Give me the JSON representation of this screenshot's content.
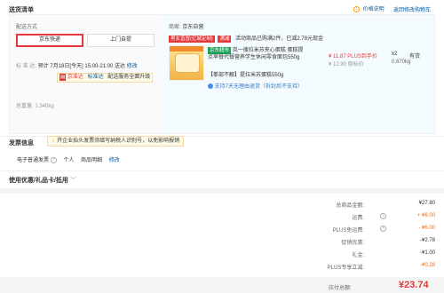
{
  "header": {
    "title": "送货清单",
    "price_note": "价格说明",
    "back_link": "返回修改购物车"
  },
  "shipping": {
    "label": "配送方式",
    "option_jd": "京东快递",
    "option_pickup": "上门自提",
    "time_label": "标 准 达:",
    "time_value": "预计 7月18日[今天] 15:00-21:00 送达",
    "modify": "修改",
    "service_jd": "京准达",
    "service_std": "标准达",
    "service_upgrade": "配送服务全面升级",
    "weight_label": "总重量:",
    "weight_value": "1.340kg"
  },
  "goods": {
    "seller_label": "商家:",
    "seller_name": "京东自营",
    "promo_tag_red": "男女直冒(亿城定制)",
    "promo_tag_manjian": "满减",
    "promo_text": "活动商品已购满2件，已减2.78元现金",
    "badge_super": "京东超市",
    "name": "岚一搜拉米苏夹心蛋糕 蛋糕提点早餐代餐营养学生休闲零食面包550g",
    "gift_text": "【拳部不解】提拉米苏蛋糕550g",
    "support_text": "支持7天无理由退货（拆封后不支持）",
    "plus_price": "¥ 11.87 PLUS到手价",
    "orig_price": "¥ 12.90 原标价",
    "qty": "x2",
    "stock": "有货",
    "weight": "0.670kg"
  },
  "invoice": {
    "title": "发票信息",
    "tip": "开企业抬头发票须填写纳税人识别号，以免影响报销",
    "type": "电子普通发票",
    "person": "个人",
    "detail": "商品明细",
    "modify": "修改"
  },
  "coupon": {
    "title": "使用优惠/礼品卡/抵用"
  },
  "summary": {
    "rows": [
      {
        "label": "总商品金额:",
        "value": "¥27.80"
      },
      {
        "label": "运费:",
        "value": "+ ¥6.00"
      },
      {
        "label": "PLUS免运费:",
        "value": "- ¥6.00"
      },
      {
        "label": "促销优惠:",
        "value": "-¥2.78"
      },
      {
        "label": "礼金:",
        "value": "-¥1.00"
      },
      {
        "label": "PLUS专享立减:",
        "value": "-¥0.28"
      }
    ],
    "total_label": "应付总额:",
    "total_value": "¥23.74"
  },
  "colors": {
    "accent": "#e4393c",
    "link": "#005aa0",
    "orange": "#ff6600",
    "green": "#1aa45b"
  }
}
